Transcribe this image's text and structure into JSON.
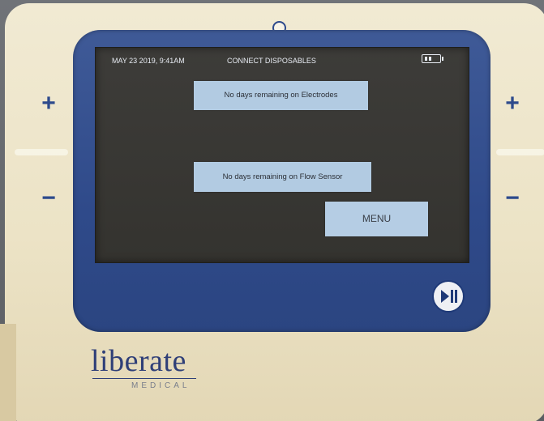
{
  "status_bar": {
    "date_time": "MAY 23 2019, 9:41AM",
    "title": "CONNECT DISPOSABLES",
    "battery_icon": "battery-icon"
  },
  "notices": {
    "electrodes": "No days remaining on Electrodes",
    "flow_sensor": "No days remaining on Flow Sensor"
  },
  "menu_button": {
    "label": "MENU"
  },
  "side_buttons": {
    "plus": "+",
    "minus": "−"
  },
  "play_pause": {
    "icon": "play-pause-icon"
  },
  "brand": {
    "name": "liberate",
    "sub": "MEDICAL"
  },
  "colors": {
    "bezel": "#2f4a8a",
    "housing": "#ece3c6",
    "notice_bg": "#b2cbe2",
    "screen_bg": "#3a3936"
  }
}
